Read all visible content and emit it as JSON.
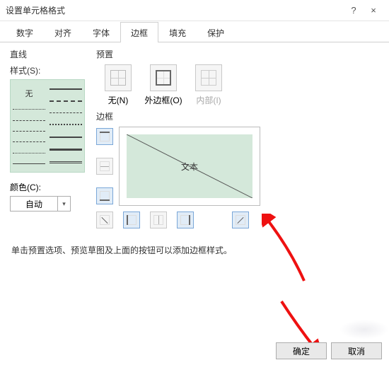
{
  "window": {
    "title": "设置单元格格式",
    "help": "?",
    "close": "×"
  },
  "tabs": [
    "数字",
    "对齐",
    "字体",
    "边框",
    "填充",
    "保护"
  ],
  "active_tab_index": 3,
  "left": {
    "section": "直线",
    "style_label": "样式(S):",
    "none_label": "无",
    "color_label": "颜色(C):",
    "color_value": "自动"
  },
  "right": {
    "preset_section": "预置",
    "presets": [
      {
        "label": "无(N)"
      },
      {
        "label": "外边框(O)"
      },
      {
        "label": "内部(I)"
      }
    ],
    "border_section": "边框",
    "preview_text": "文本"
  },
  "hint": "单击预置选项、预览草图及上面的按钮可以添加边框样式。",
  "footer": {
    "ok": "确定",
    "cancel": "取消"
  }
}
